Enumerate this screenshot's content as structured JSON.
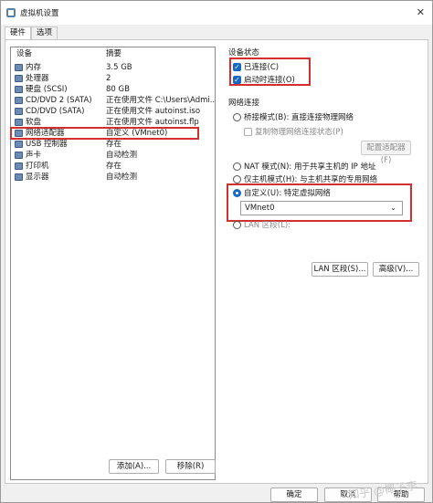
{
  "window": {
    "title": "虚拟机设置",
    "close_label": "✕"
  },
  "tabs": [
    {
      "label": "硬件"
    },
    {
      "label": "选项"
    }
  ],
  "device_list": {
    "header_device": "设备",
    "header_summary": "摘要",
    "rows": [
      {
        "name": "内存",
        "summary": "3.5 GB"
      },
      {
        "name": "处理器",
        "summary": "2"
      },
      {
        "name": "硬盘 (SCSI)",
        "summary": "80 GB"
      },
      {
        "name": "CD/DVD 2 (SATA)",
        "summary": "正在使用文件 C:\\Users\\Admi..."
      },
      {
        "name": "CD/DVD (SATA)",
        "summary": "正在使用文件 autoinst.iso"
      },
      {
        "name": "软盘",
        "summary": "正在使用文件 autoinst.flp"
      },
      {
        "name": "网络适配器",
        "summary": "自定义 (VMnet0)"
      },
      {
        "name": "USB 控制器",
        "summary": "存在"
      },
      {
        "name": "声卡",
        "summary": "自动检测"
      },
      {
        "name": "打印机",
        "summary": "存在"
      },
      {
        "name": "显示器",
        "summary": "自动检测"
      }
    ]
  },
  "device_status": {
    "title": "设备状态",
    "connected": "已连接(C)",
    "connect_at_power_on": "启动时连接(O)"
  },
  "network": {
    "title": "网络连接",
    "bridged": "桥接模式(B): 直接连接物理网络",
    "replicate": "复制物理网络连接状态(P)",
    "configure_adapters": "配置适配器(F)",
    "nat": "NAT 模式(N): 用于共享主机的 IP 地址",
    "host_only": "仅主机模式(H): 与主机共享的专用网络",
    "custom": "自定义(U): 特定虚拟网络",
    "custom_value": "VMnet0",
    "lan_segment": "LAN 区段(L):",
    "lan_segments_button": "LAN 区段(S)...",
    "advanced_button": "高级(V)..."
  },
  "buttons": {
    "add": "添加(A)...",
    "remove": "移除(R)",
    "ok": "确定",
    "cancel": "取消",
    "help": "帮助"
  },
  "watermark": "知乎 @椰子李"
}
